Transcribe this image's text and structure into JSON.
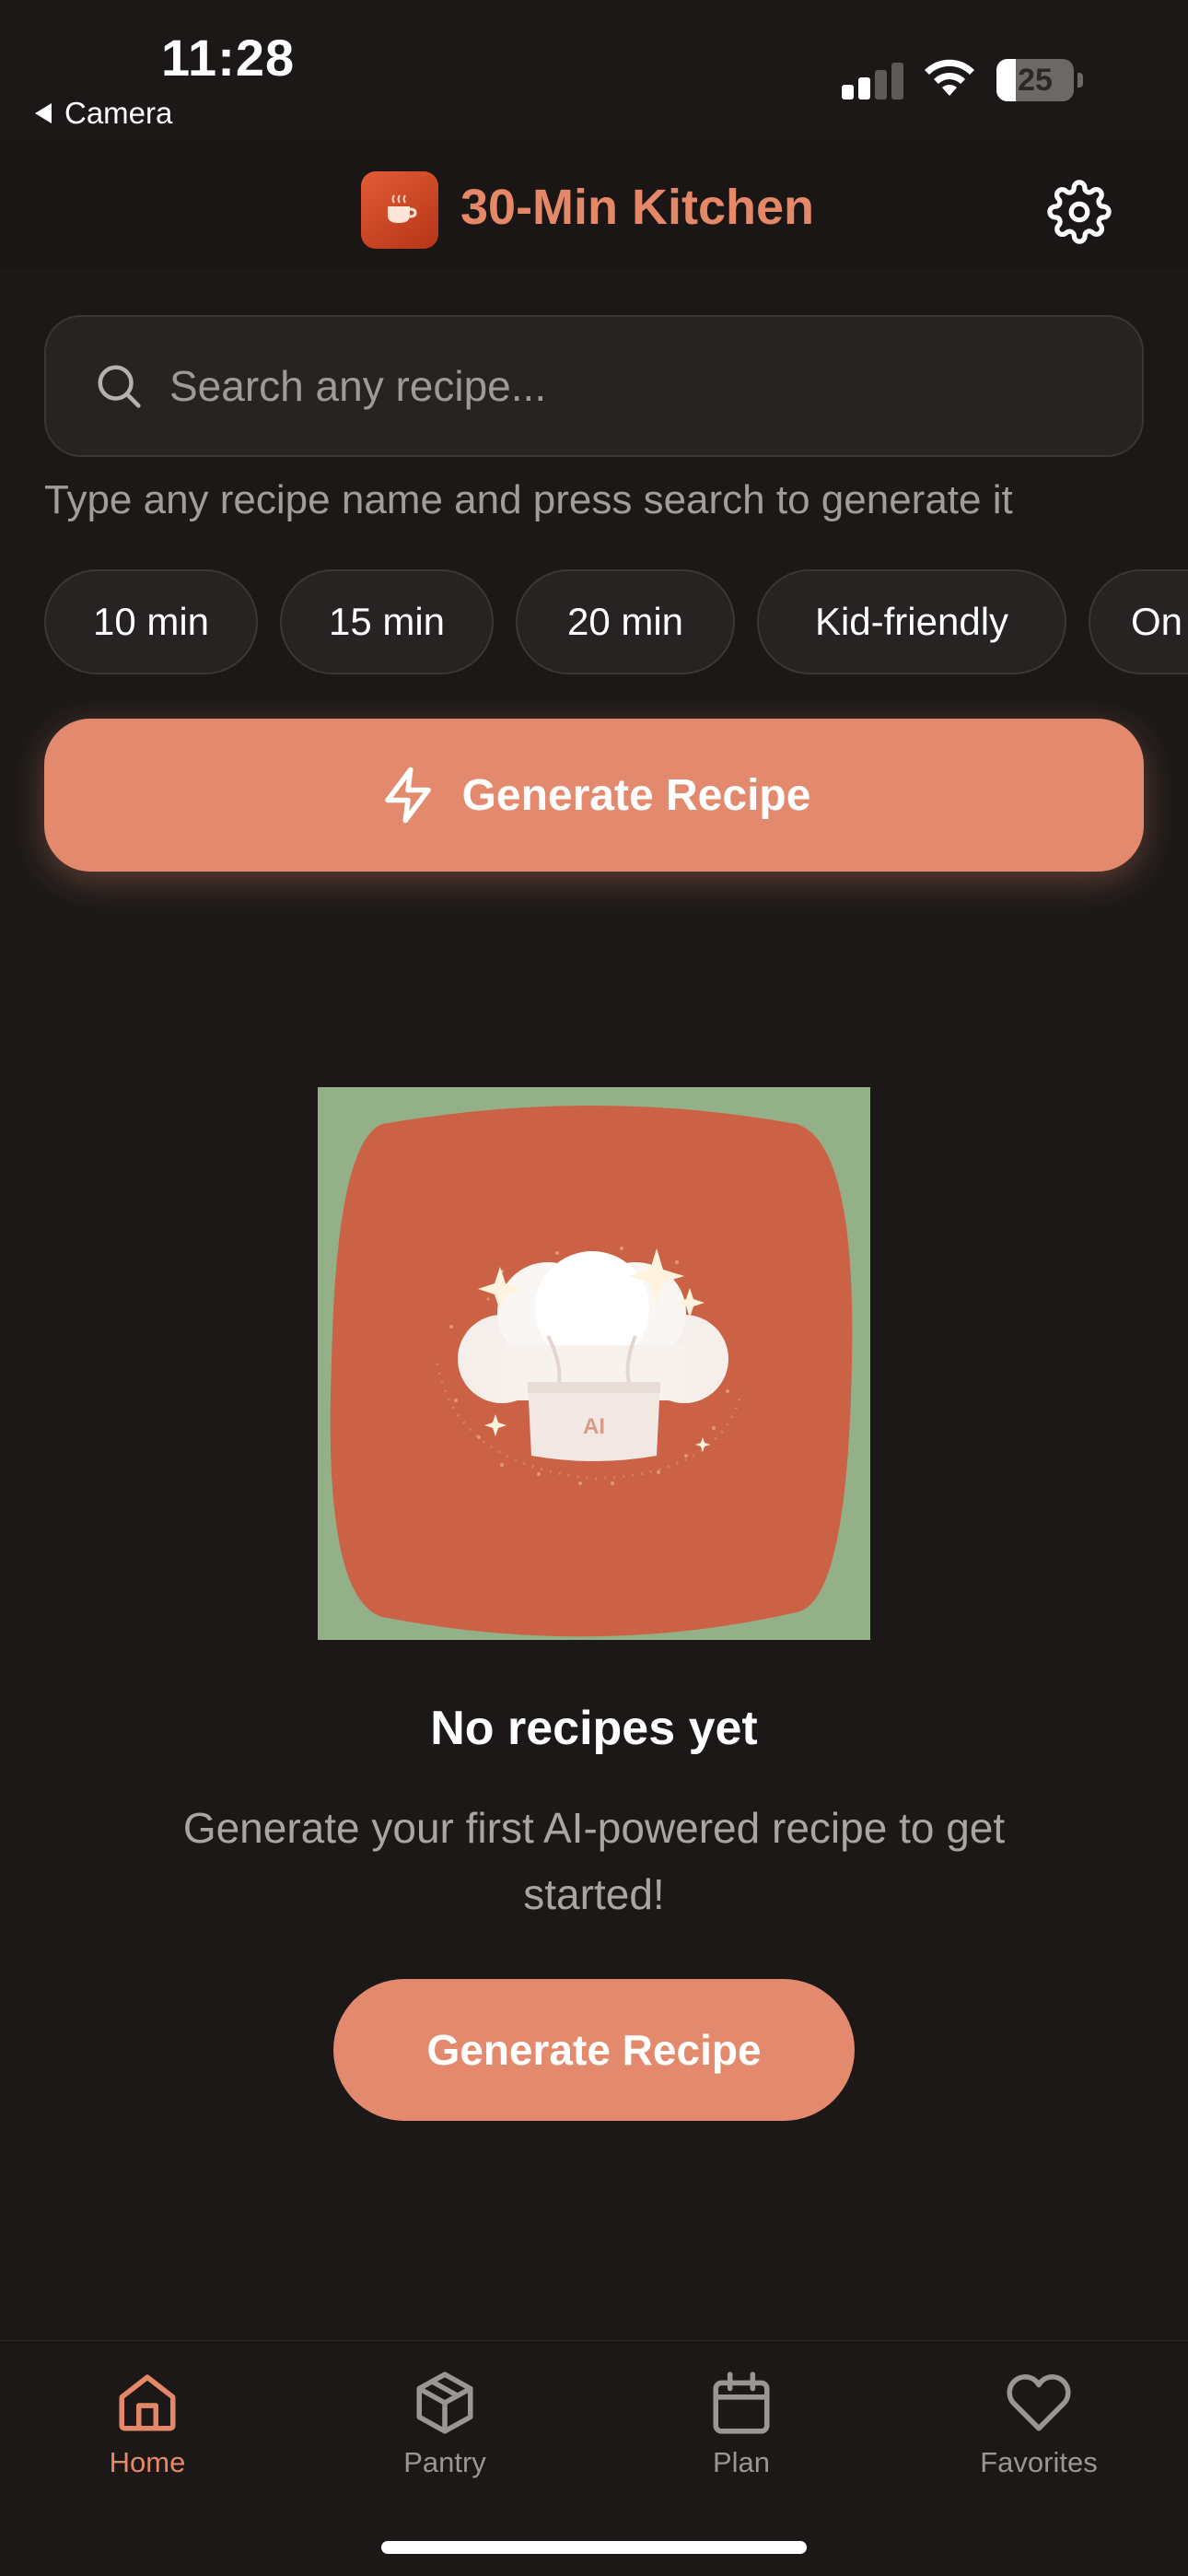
{
  "status_bar": {
    "time": "11:28",
    "back_label": "Camera",
    "battery_level": 25,
    "battery_text": "25",
    "signal_bars_active": 2
  },
  "header": {
    "title": "30-Min Kitchen",
    "logo_icon": "coffee-cup-icon",
    "settings_icon": "gear-icon"
  },
  "search": {
    "placeholder": "Search any recipe...",
    "value": "",
    "hint": "Type any recipe name and press search to generate it"
  },
  "chips": [
    {
      "label": "10 min"
    },
    {
      "label": "15 min"
    },
    {
      "label": "20 min"
    },
    {
      "label": "Kid-friendly"
    },
    {
      "label": "On"
    }
  ],
  "generate_button": {
    "label": "Generate Recipe",
    "icon": "lightning-bolt-icon"
  },
  "empty_state": {
    "illustration_text": "AI",
    "title": "No recipes yet",
    "description": "Generate your first AI-powered recipe to get started!",
    "button_label": "Generate Recipe"
  },
  "tab_bar": {
    "tabs": [
      {
        "label": "Home",
        "icon": "home-icon",
        "active": true
      },
      {
        "label": "Pantry",
        "icon": "box-icon",
        "active": false
      },
      {
        "label": "Plan",
        "icon": "calendar-icon",
        "active": false
      },
      {
        "label": "Favorites",
        "icon": "heart-icon",
        "active": false
      }
    ]
  },
  "colors": {
    "background": "#1b1817",
    "accent": "#e38a6e",
    "title_accent": "#e58868",
    "surface": "#262322",
    "illustration_bg": "#93b089",
    "illustration_blob": "#cc6245"
  }
}
